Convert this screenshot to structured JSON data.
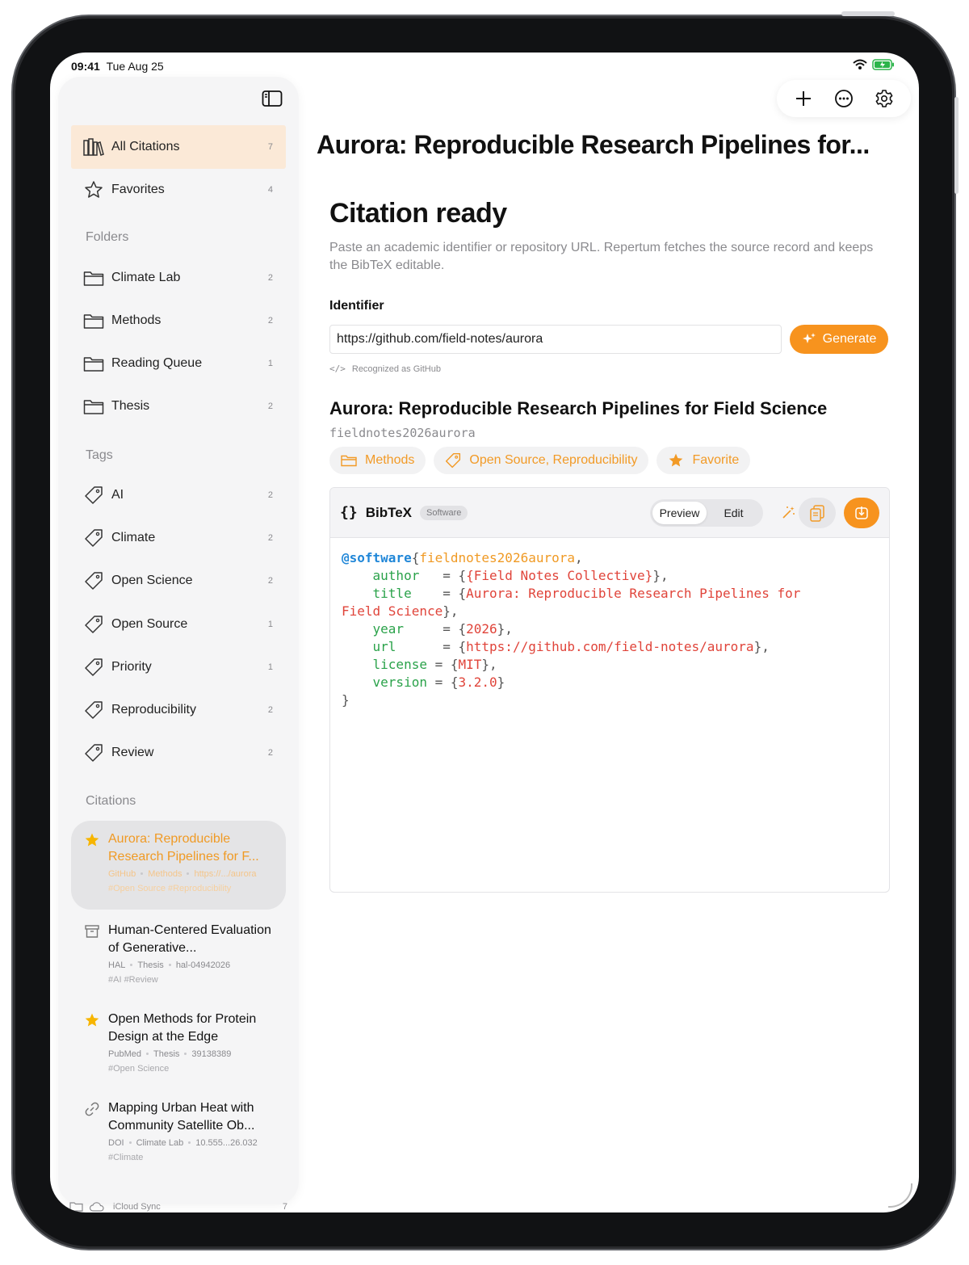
{
  "status": {
    "time": "09:41",
    "date": "Tue Aug 25"
  },
  "sidebar": {
    "library": [
      {
        "label": "All Citations",
        "count": "7",
        "icon": "books-icon"
      },
      {
        "label": "Favorites",
        "count": "4",
        "icon": "star-icon"
      }
    ],
    "folders_header": "Folders",
    "folders": [
      {
        "label": "Climate Lab",
        "count": "2"
      },
      {
        "label": "Methods",
        "count": "2"
      },
      {
        "label": "Reading Queue",
        "count": "1"
      },
      {
        "label": "Thesis",
        "count": "2"
      }
    ],
    "tags_header": "Tags",
    "tags": [
      {
        "label": "AI",
        "count": "2"
      },
      {
        "label": "Climate",
        "count": "2"
      },
      {
        "label": "Open Science",
        "count": "2"
      },
      {
        "label": "Open Source",
        "count": "1"
      },
      {
        "label": "Priority",
        "count": "1"
      },
      {
        "label": "Reproducibility",
        "count": "2"
      },
      {
        "label": "Review",
        "count": "2"
      }
    ],
    "citations_header": "Citations",
    "citations": [
      {
        "title": "Aurora: Reproducible Research Pipelines for F...",
        "meta": [
          "GitHub",
          "Methods",
          "https://.../aurora"
        ],
        "tags": "#Open Source  #Reproducibility",
        "icon": "star-icon"
      },
      {
        "title": "Human-Centered Evaluation of Generative...",
        "meta": [
          "HAL",
          "Thesis",
          "hal-04942026"
        ],
        "tags": "#AI  #Review",
        "icon": "archive-icon"
      },
      {
        "title": "Open Methods for Protein Design at the Edge",
        "meta": [
          "PubMed",
          "Thesis",
          "39138389"
        ],
        "tags": "#Open Science",
        "icon": "star-icon"
      },
      {
        "title": "Mapping Urban Heat with Community Satellite Ob...",
        "meta": [
          "DOI",
          "Climate Lab",
          "10.555...26.032"
        ],
        "tags": "#Climate",
        "icon": "link-icon"
      }
    ],
    "footer": {
      "label": "iCloud Sync",
      "count": "7"
    }
  },
  "main": {
    "title": "Aurora: Reproducible Research Pipelines for...",
    "heading": "Citation ready",
    "description": "Paste an academic identifier or repository URL. Repertum fetches the source record and keeps the BibTeX editable.",
    "identifier_label": "Identifier",
    "identifier_value": "https://github.com/field-notes/aurora",
    "generate_label": "Generate",
    "recognized": "Recognized as GitHub",
    "paper_title": "Aurora: Reproducible Research Pipelines for Field Science",
    "citekey": "fieldnotes2026aurora",
    "chips": {
      "folder": "Methods",
      "tags": "Open Source, Reproducibility",
      "favorite": "Favorite"
    }
  },
  "bibtex": {
    "header": "BibTeX",
    "badge": "Software",
    "preview_label": "Preview",
    "edit_label": "Edit",
    "entry_type": "@software",
    "key": "fieldnotes2026aurora",
    "fields": [
      {
        "name": "author",
        "pad": "  ",
        "value": "{Field Notes Collective}"
      },
      {
        "name": "title",
        "pad": "   ",
        "value": "Aurora: Reproducible Research Pipelines for"
      },
      {
        "name": "year",
        "pad": "    ",
        "value": "2026"
      },
      {
        "name": "url",
        "pad": "     ",
        "value": "https://github.com/field-notes/aurora"
      },
      {
        "name": "license",
        "pad": "",
        "value": "MIT"
      },
      {
        "name": "version",
        "pad": "",
        "value": "3.2.0"
      }
    ],
    "title_cont": "Field Science"
  },
  "colors": {
    "accent": "#f7931e",
    "active_bg": "#fbe9d7"
  }
}
